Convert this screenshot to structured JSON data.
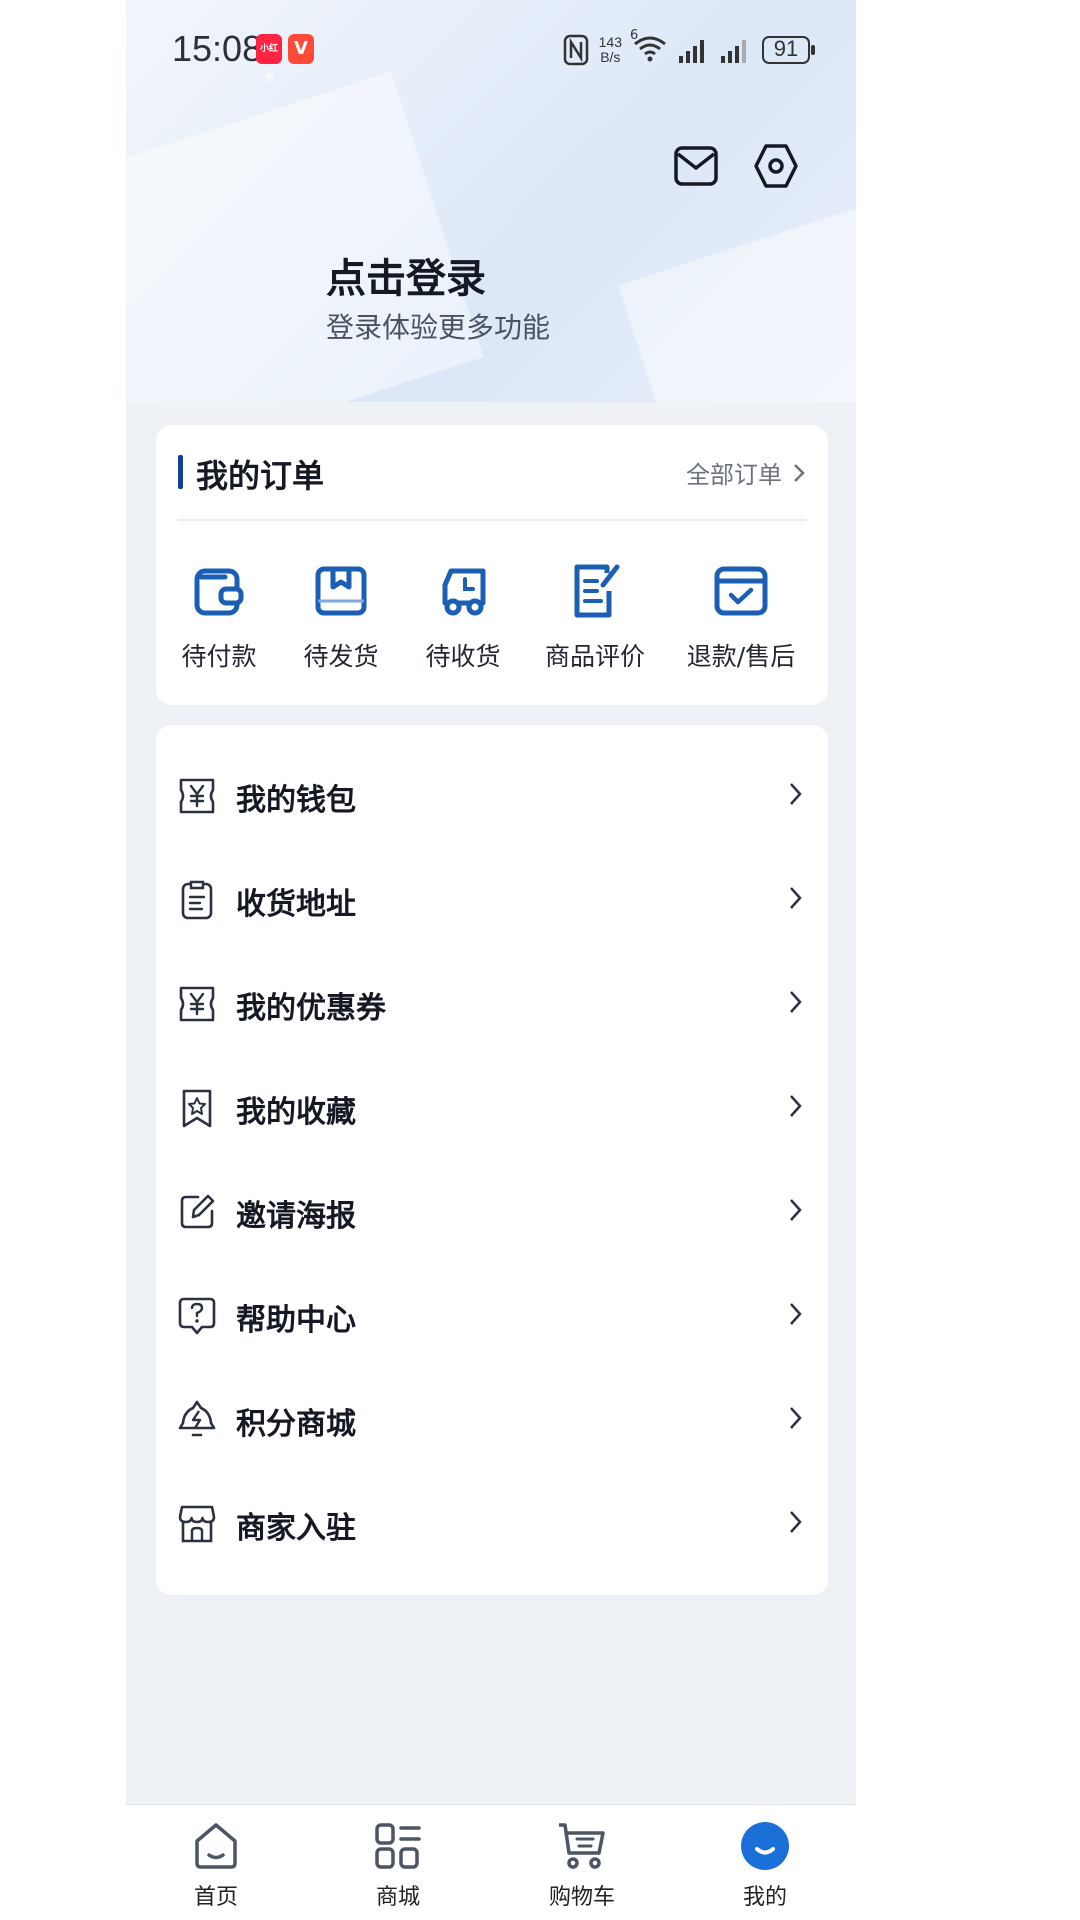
{
  "status_bar": {
    "time": "15:08",
    "app_badge_red": "小红书",
    "app_badge_v": "V",
    "net_speed_value": "143",
    "net_speed_unit": "B/s",
    "wifi_label": "6",
    "battery": "91",
    "icons": [
      "nfc-icon",
      "wifi-icon",
      "signal-icon",
      "signal-icon",
      "battery-icon"
    ]
  },
  "header": {
    "login_title": "点击登录",
    "login_subtitle": "登录体验更多功能",
    "icons": [
      "mail-icon",
      "settings-icon"
    ]
  },
  "orders": {
    "title": "我的订单",
    "all_orders": "全部订单",
    "items": [
      {
        "label": "待付款",
        "icon": "wallet-icon"
      },
      {
        "label": "待发货",
        "icon": "package-icon"
      },
      {
        "label": "待收货",
        "icon": "truck-icon"
      },
      {
        "label": "商品评价",
        "icon": "review-icon"
      },
      {
        "label": "退款/售后",
        "icon": "refund-icon"
      }
    ]
  },
  "menu": {
    "items": [
      {
        "label": "我的钱包",
        "icon": "yuan-icon"
      },
      {
        "label": "收货地址",
        "icon": "clipboard-icon"
      },
      {
        "label": "我的优惠券",
        "icon": "coupon-icon"
      },
      {
        "label": "我的收藏",
        "icon": "bookmark-star-icon"
      },
      {
        "label": "邀请海报",
        "icon": "edit-icon"
      },
      {
        "label": "帮助中心",
        "icon": "help-icon"
      },
      {
        "label": "积分商城",
        "icon": "points-icon"
      },
      {
        "label": "商家入驻",
        "icon": "store-icon"
      }
    ]
  },
  "tabbar": {
    "tabs": [
      {
        "label": "首页",
        "icon": "home-icon"
      },
      {
        "label": "商城",
        "icon": "grid-icon"
      },
      {
        "label": "购物车",
        "icon": "cart-icon"
      },
      {
        "label": "我的",
        "icon": "profile-icon",
        "active": true
      }
    ]
  },
  "colors": {
    "accent": "#12428f",
    "icon_blue": "#1a5fb4",
    "text_primary": "#141923",
    "background": "#eef2f6"
  }
}
